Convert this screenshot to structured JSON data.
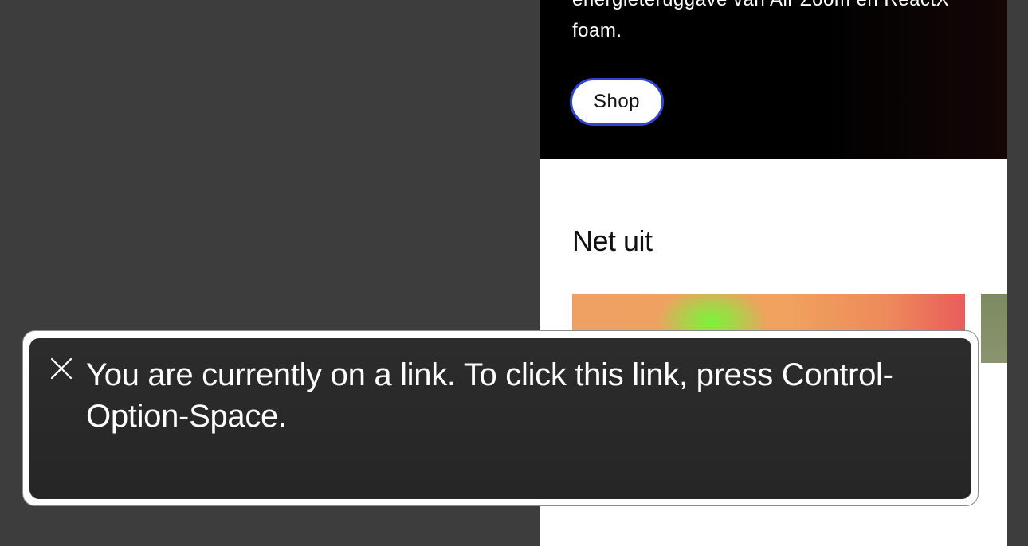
{
  "hero": {
    "text": "energieteruggave van Air Zoom en ReactX foam.",
    "shop_label": "Shop"
  },
  "section": {
    "title": "Net uit"
  },
  "voiceover": {
    "message": "You are currently on a link. To click this link, press Control-Option-Space."
  },
  "icons": {
    "close": "close-icon"
  },
  "colors": {
    "background": "#3d3d3d",
    "hero_background": "#000000",
    "focus_ring": "#2f45d6",
    "panel_background": "#2a2a2a"
  }
}
